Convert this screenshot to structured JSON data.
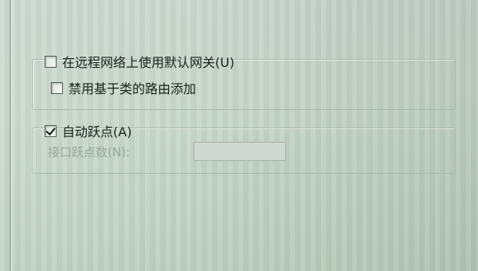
{
  "options": {
    "use_default_gateway": {
      "label": "在远程网络上使用默认网关(U)",
      "checked": false
    },
    "disable_class_based_route": {
      "label": "禁用基于类的路由添加",
      "checked": false
    },
    "automatic_metric": {
      "label": "自动跃点(A)",
      "checked": true
    }
  },
  "interface_metric": {
    "label": "接口跃点数(N):",
    "value": "",
    "enabled": false
  }
}
